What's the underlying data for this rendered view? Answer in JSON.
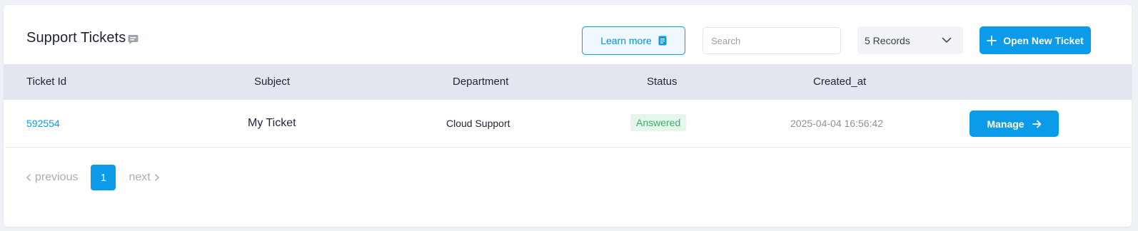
{
  "header": {
    "title": "Support Tickets",
    "learn_more_label": "Learn more",
    "search_placeholder": "Search",
    "records_selected": "5 Records",
    "open_ticket_label": "Open New Ticket"
  },
  "table": {
    "columns": [
      "Ticket Id",
      "Subject",
      "Department",
      "Status",
      "Created_at"
    ],
    "rows": [
      {
        "ticket_id": "592554",
        "subject": "My Ticket",
        "department": "Cloud Support",
        "status": "Answered",
        "created_at": "2025-04-04 16:56:42",
        "action_label": "Manage"
      }
    ]
  },
  "pagination": {
    "previous_label": "previous",
    "current_page": "1",
    "next_label": "next"
  },
  "colors": {
    "accent": "#0b9be8",
    "header_bg": "#e3e6ef",
    "status_answered_bg": "#e6f6ec",
    "status_answered_text": "#34b26a"
  },
  "icons": {
    "title": "chat-bubble-icon",
    "learn_more": "document-icon",
    "records": "chevron-down-icon",
    "open_ticket": "plus-icon",
    "manage": "arrow-right-icon",
    "previous": "chevron-left-icon",
    "next": "chevron-right-icon"
  }
}
